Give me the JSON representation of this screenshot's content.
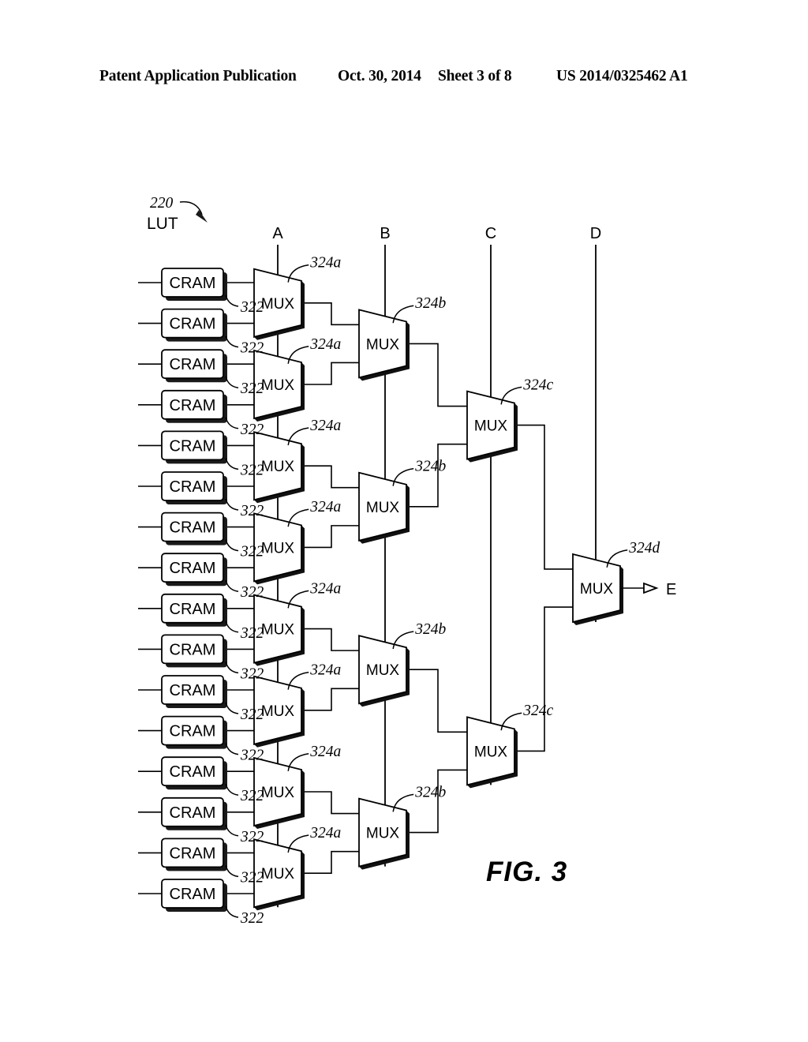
{
  "header": {
    "publication": "Patent Application Publication",
    "date": "Oct. 30, 2014",
    "sheet": "Sheet 3 of 8",
    "patent_number": "US 2014/0325462 A1"
  },
  "figure": {
    "caption": "FIG. 3",
    "block_label": "LUT",
    "block_ref": "220",
    "cram_label": "CRAM",
    "mux_label": "MUX",
    "cram_ref": "322",
    "mux_ref_level1": "324a",
    "mux_ref_level2": "324b",
    "mux_ref_level3": "324c",
    "mux_ref_level4": "324d",
    "select_lines": [
      "A",
      "B",
      "C",
      "D"
    ],
    "output_label": "E",
    "cram_count": 16,
    "mux_level1_count": 8,
    "mux_level2_count": 4,
    "mux_level3_count": 2,
    "mux_level4_count": 1,
    "cram_refs": [
      "322",
      "322",
      "322",
      "322",
      "322",
      "322",
      "322",
      "322",
      "322",
      "322",
      "322",
      "322",
      "322",
      "322",
      "322",
      "322"
    ],
    "mux_level1_refs": [
      "324a",
      "324a",
      "324a",
      "324a",
      "324a",
      "324a",
      "324a",
      "324a"
    ],
    "mux_level2_refs": [
      "324b",
      "324b",
      "324b",
      "324b"
    ],
    "mux_level3_refs": [
      "324c",
      "324c"
    ],
    "mux_level4_refs": [
      "324d"
    ]
  },
  "colors": {
    "ink": "#000000",
    "paper": "#ffffff",
    "shadow": "#111111"
  }
}
